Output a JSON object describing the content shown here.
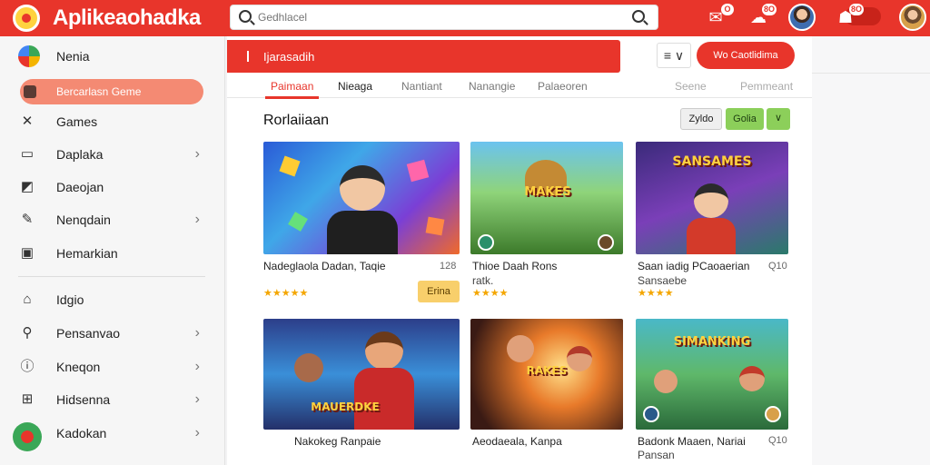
{
  "header": {
    "app_title": "Aplikeaohadka",
    "search_placeholder": "Gedhlacel",
    "notif_badges": [
      "O",
      "8O",
      "8O"
    ],
    "accent": "#e8352b"
  },
  "sidebar": {
    "head_label": "Nenia",
    "active_label": "Bercarlasn Geme",
    "items": [
      {
        "label": "Games",
        "icon": "controller-icon",
        "chevron": false
      },
      {
        "label": "Daplaka",
        "icon": "monitor-icon",
        "chevron": true
      },
      {
        "label": "Daeojan",
        "icon": "edit-icon",
        "chevron": false
      },
      {
        "label": "Nenqdain",
        "icon": "pencil-icon",
        "chevron": true
      },
      {
        "label": "Hemarkian",
        "icon": "square-icon",
        "chevron": false
      },
      {
        "label": "Idgio",
        "icon": "home-icon",
        "chevron": false
      },
      {
        "label": "Pensanvao",
        "icon": "search-icon",
        "chevron": true
      },
      {
        "label": "Kneqon",
        "icon": "info-icon",
        "chevron": true
      },
      {
        "label": "Hidsenna",
        "icon": "grid-icon",
        "chevron": true
      },
      {
        "label": "Kadokan",
        "icon": "globe-icon",
        "chevron": true
      }
    ]
  },
  "toolbar": {
    "banner_label": "Ijarasadih",
    "filter_label": "≡ ∨",
    "cta_label": "Wo Caotlidima"
  },
  "tabs": [
    {
      "label": "Paimaan",
      "state": "active"
    },
    {
      "label": "Nieaga",
      "state": "dark"
    },
    {
      "label": "Nantiant",
      "state": "normal"
    },
    {
      "label": "Nanangie",
      "state": "normal"
    },
    {
      "label": "Palaeoren",
      "state": "normal"
    },
    {
      "label": "Seene",
      "state": "muted"
    },
    {
      "label": "Pemmeant",
      "state": "muted"
    }
  ],
  "section": {
    "title": "Rorlaiiaan",
    "sort_label": "Zyldo",
    "filter_label": "Golia",
    "dropdown_glyph": "∨"
  },
  "cards": [
    {
      "title": "Nadeglaola Dadan, Taqie",
      "subtitle": "",
      "number": "128",
      "rating": "★★★★★",
      "action": "Erina",
      "banner": ""
    },
    {
      "title": "Thioe Daah Rons",
      "subtitle": "ratk.",
      "number": "",
      "rating": "★★★★",
      "action": "",
      "banner": "MAKES"
    },
    {
      "title": "Saan iadig PCaoaerian",
      "subtitle": "Sansaebe",
      "number": "Q10",
      "rating": "★★★★",
      "action": "",
      "banner": "SANSAMES"
    },
    {
      "title": "Nakokeg Ranpaie",
      "subtitle": "",
      "number": "",
      "rating": "",
      "action": "",
      "banner": "MAUERDKE"
    },
    {
      "title": "Aeodaeala, Kanpa",
      "subtitle": "",
      "number": "",
      "rating": "",
      "action": "",
      "banner": "RAKES"
    },
    {
      "title": "Badonk Maaen, Nariai",
      "subtitle": "Pansan",
      "number": "Q10",
      "rating": "",
      "action": "",
      "banner": "SIMANKING"
    }
  ]
}
